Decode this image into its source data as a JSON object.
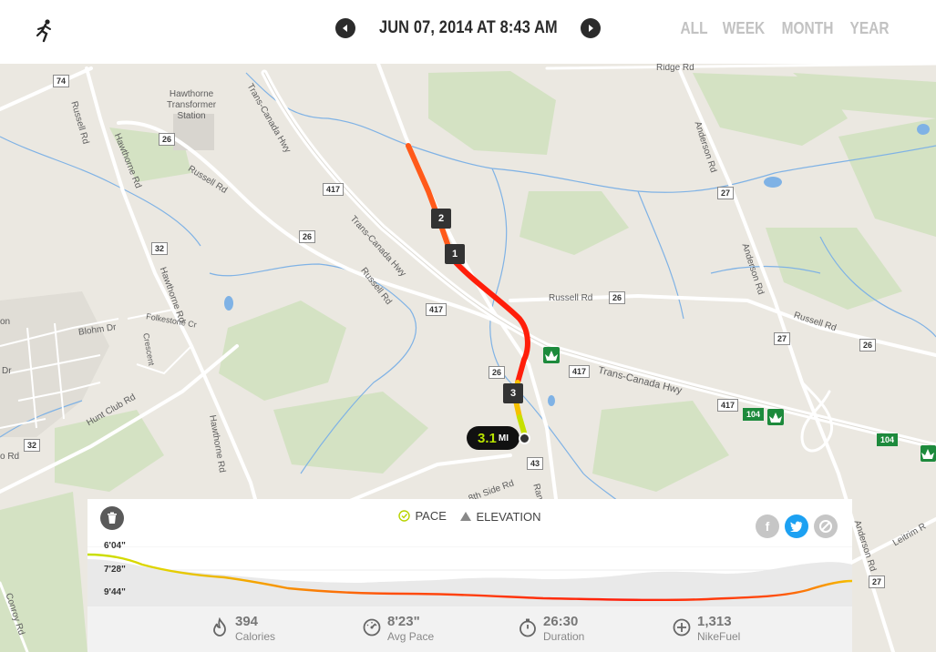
{
  "header": {
    "date_title": "JUN 07, 2014 AT 8:43 AM",
    "range_tabs": [
      "ALL",
      "WEEK",
      "MONTH",
      "YEAR"
    ]
  },
  "map": {
    "labels": {
      "ridge_rd": "Ridge Rd",
      "russell_rd_w": "Russell Rd",
      "hawthorne_rd_n": "Hawthorne Rd",
      "hawthorne_station": "Hawthorne\nTransformer\nStation",
      "trans_canada_n": "Trans-Canada Hwy",
      "russell_rd_mid": "Russell Rd",
      "trans_canada_mid": "Trans-Canada Hwy",
      "russell_rd_sw": "Russell Rd",
      "hawthorne_rd_mid": "Hawthorne Rd",
      "blohm_dr": "Blohm Dr",
      "folkestone_cr": "Folkestone Cr",
      "crescent": "Crescent",
      "hunt_club_rd": "Hunt Club Rd",
      "hawthorne_rd_s": "Hawthorne Rd",
      "anderson_rd_n": "Anderson Rd",
      "anderson_rd_mid": "Anderson Rd",
      "russell_rd_e": "Russell Rd",
      "russell_rd_e2": "Russell Rd",
      "trans_canada_e": "Trans-Canada Hwy",
      "side_rd": "8th Side Rd",
      "rang": "Rang",
      "leitrim": "Leitrim R",
      "anderson_rd_s": "Anderson Rd",
      "conroy_rd": "Conroy Rd",
      "dr_w": "Dr",
      "on_w": "on",
      "o_rd": "o Rd"
    },
    "shields": {
      "s74": "74",
      "s26a": "26",
      "s417a": "417",
      "s26b": "26",
      "s32a": "32",
      "s417b": "417",
      "s26c": "26",
      "s26d": "26",
      "s417c": "417",
      "s27a": "27",
      "s27b": "27",
      "s26e": "26",
      "s417d": "417",
      "s104a": "104",
      "s104b": "104",
      "s43": "43",
      "s32b": "32",
      "s27c": "27"
    },
    "km_markers": [
      "1",
      "2",
      "3"
    ],
    "distance_value": "3.1",
    "distance_unit": "MI"
  },
  "panel": {
    "legend_pace": "PACE",
    "legend_elevation": "ELEVATION",
    "y_labels": [
      "6'04\"",
      "7'28\"",
      "9'44\""
    ],
    "stats": [
      {
        "value": "394",
        "label": "Calories"
      },
      {
        "value": "8'23\"",
        "label": "Avg Pace"
      },
      {
        "value": "26:30",
        "label": "Duration"
      },
      {
        "value": "1,313",
        "label": "NikeFuel"
      }
    ]
  },
  "colors": {
    "route_fast": "#c6e000",
    "route_mid": "#f5b400",
    "route_slow": "#ff2a00",
    "water": "#7fb2e5",
    "park": "#c9dcb6",
    "twitter": "#1da1f2"
  }
}
